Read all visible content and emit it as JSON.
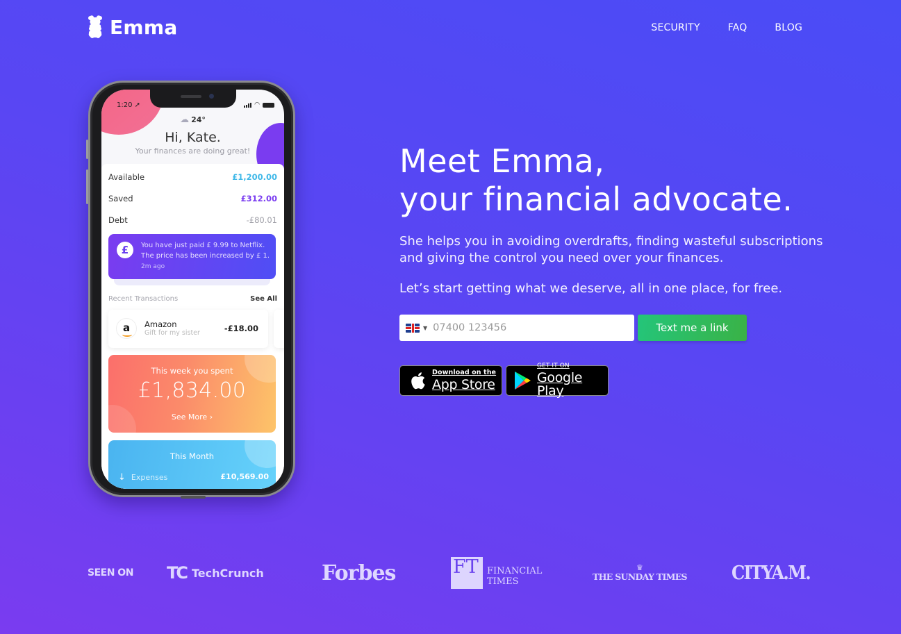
{
  "brand": {
    "name": "Emma",
    "logo_icon": "gummy-bear-icon"
  },
  "nav": {
    "items": [
      {
        "label": "SECURITY"
      },
      {
        "label": "FAQ"
      },
      {
        "label": "BLOG"
      }
    ]
  },
  "phone_mockup": {
    "status_time": "1:20",
    "weather": {
      "icon": "rain-cloud-icon",
      "temp": "24°"
    },
    "greeting": "Hi, Kate.",
    "greeting_sub": "Your finances are doing great!",
    "balances": [
      {
        "label": "Available",
        "value": "£1,200.00",
        "color": "#3fb8e8"
      },
      {
        "label": "Saved",
        "value": "£312.00",
        "color": "#7a3cf0"
      },
      {
        "label": "Debt",
        "value": "-£80.01",
        "color": "#a0a0a8"
      }
    ],
    "notification": {
      "icon": "pound-coin-icon",
      "line1": "You have just paid £ 9.99 to Netflix.",
      "line2": "The price has been increased by £ 1.",
      "time": "2m ago"
    },
    "recent": {
      "title": "Recent Transactions",
      "see_all": "See All",
      "transaction": {
        "merchant": "Amazon",
        "note": "Gift for my sister",
        "amount": "-£18.00",
        "icon": "amazon-logo-icon"
      }
    },
    "week_card": {
      "title": "This week you spent",
      "amount": "£1,834.00",
      "more": "See More"
    },
    "month_card": {
      "title": "This Month",
      "expenses_label": "Expenses",
      "expenses_value": "£10,569.00"
    }
  },
  "hero": {
    "headline_line1": "Meet Emma,",
    "headline_line2": "your financial advocate.",
    "description": "She helps you in avoiding overdrafts, finding wasteful subscriptions and giving the control you need over your finances.",
    "tagline": "Let’s start getting what we deserve, all in one place, for free.",
    "phone_input": {
      "country": "UK",
      "placeholder": "07400 123456",
      "value": ""
    },
    "cta_label": "Text me a link",
    "app_store": {
      "small": "Download on the",
      "big": "App Store"
    },
    "google_play": {
      "small": "GET IT ON",
      "big": "Google Play"
    }
  },
  "press": {
    "label": "SEEN ON",
    "outlets": [
      {
        "name": "TechCrunch",
        "mark": "TC"
      },
      {
        "name": "Forbes"
      },
      {
        "name_line1": "FINANCIAL",
        "name_line2": "TIMES",
        "mark": "FT"
      },
      {
        "name": "THE SUNDAY TIMES"
      },
      {
        "name": "CITYA.M."
      }
    ]
  },
  "colors": {
    "bg_top_right": "#4a4cf6",
    "bg_bottom_left": "#7a3cf0",
    "cta_green": "#2bbd64",
    "accent_purple": "#7a3cf0"
  }
}
